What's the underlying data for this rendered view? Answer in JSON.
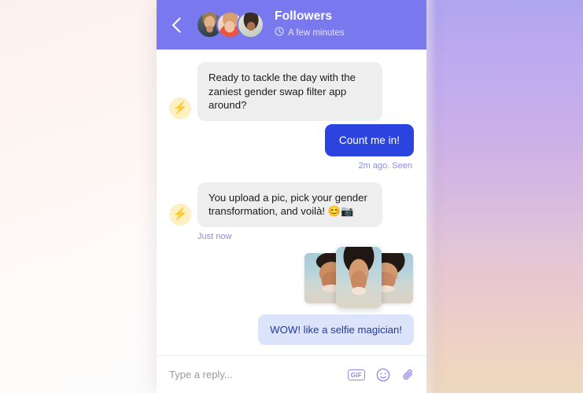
{
  "theme": {
    "header_purple": "#7a78ee",
    "accent_blue": "#2b44e0",
    "light_blue_bubble": "#dce4fb",
    "incoming_grey": "#eeeeee",
    "meta_purple": "#8a8ce8",
    "bot_avatar_yellow": "#fdf0c3"
  },
  "header": {
    "back_icon": "chevron-left-icon",
    "title": "Followers",
    "clock_icon": "clock-icon",
    "subtitle": "A few minutes",
    "avatars": [
      {
        "name": "avatar-participant-1"
      },
      {
        "name": "avatar-participant-2"
      },
      {
        "name": "avatar-participant-3"
      }
    ]
  },
  "messages": [
    {
      "id": "msg-1",
      "side": "incoming",
      "avatar_icon": "lightning-bolt-icon",
      "avatar_emoji": "⚡",
      "text": "Ready to tackle the day with the zaniest gender swap filter app around?"
    },
    {
      "id": "msg-2",
      "side": "outgoing",
      "style": "primary",
      "text": "Count me in!",
      "meta": "2m ago. Seen"
    },
    {
      "id": "msg-3",
      "side": "incoming",
      "avatar_icon": "lightning-bolt-icon",
      "avatar_emoji": "⚡",
      "text": "You upload a pic, pick your gender transformation, and voilà! 😊📷",
      "meta": "Just now"
    },
    {
      "id": "msg-4",
      "side": "outgoing",
      "style": "attachment",
      "photos": [
        {
          "name": "photo-result-male",
          "alt": "male transformation result"
        },
        {
          "name": "photo-result-female-featured",
          "alt": "female transformation result"
        },
        {
          "name": "photo-result-female",
          "alt": "female transformation result"
        }
      ]
    },
    {
      "id": "msg-5",
      "side": "outgoing",
      "style": "light",
      "text": "WOW! like a selfie magician!"
    }
  ],
  "composer": {
    "placeholder": "Type a reply...",
    "value": "",
    "gif_label": "GIF",
    "emoji_icon": "smiley-icon",
    "attach_icon": "paperclip-icon"
  }
}
